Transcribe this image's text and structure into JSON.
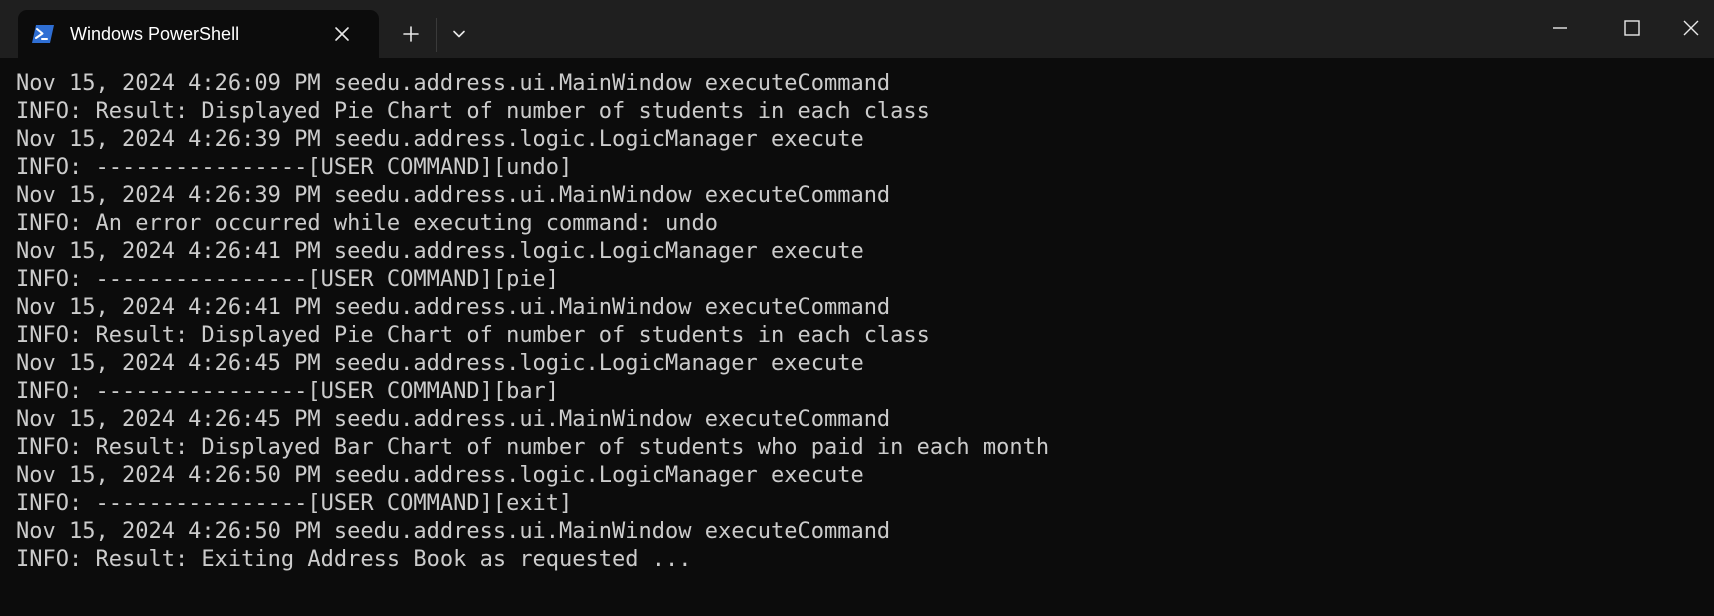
{
  "window": {
    "tab_title": "Windows PowerShell",
    "tab_icon": "powershell-icon",
    "tab_close_icon": "close-icon",
    "new_tab_icon": "plus-icon",
    "dropdown_icon": "chevron-down-icon",
    "minimize_icon": "minimize-icon",
    "maximize_icon": "maximize-icon",
    "close_icon": "close-icon"
  },
  "colors": {
    "titlebar_bg": "#1f1f1f",
    "console_bg": "#0c0c0c",
    "text": "#cccccc",
    "icon_blue": "#2f6fd4"
  },
  "console": {
    "lines": [
      "Nov 15, 2024 4:26:09 PM seedu.address.ui.MainWindow executeCommand",
      "INFO: Result: Displayed Pie Chart of number of students in each class",
      "Nov 15, 2024 4:26:39 PM seedu.address.logic.LogicManager execute",
      "INFO: ----------------[USER COMMAND][undo]",
      "Nov 15, 2024 4:26:39 PM seedu.address.ui.MainWindow executeCommand",
      "INFO: An error occurred while executing command: undo",
      "Nov 15, 2024 4:26:41 PM seedu.address.logic.LogicManager execute",
      "INFO: ----------------[USER COMMAND][pie]",
      "Nov 15, 2024 4:26:41 PM seedu.address.ui.MainWindow executeCommand",
      "INFO: Result: Displayed Pie Chart of number of students in each class",
      "Nov 15, 2024 4:26:45 PM seedu.address.logic.LogicManager execute",
      "INFO: ----------------[USER COMMAND][bar]",
      "Nov 15, 2024 4:26:45 PM seedu.address.ui.MainWindow executeCommand",
      "INFO: Result: Displayed Bar Chart of number of students who paid in each month",
      "Nov 15, 2024 4:26:50 PM seedu.address.logic.LogicManager execute",
      "INFO: ----------------[USER COMMAND][exit]",
      "Nov 15, 2024 4:26:50 PM seedu.address.ui.MainWindow executeCommand",
      "INFO: Result: Exiting Address Book as requested ..."
    ]
  }
}
